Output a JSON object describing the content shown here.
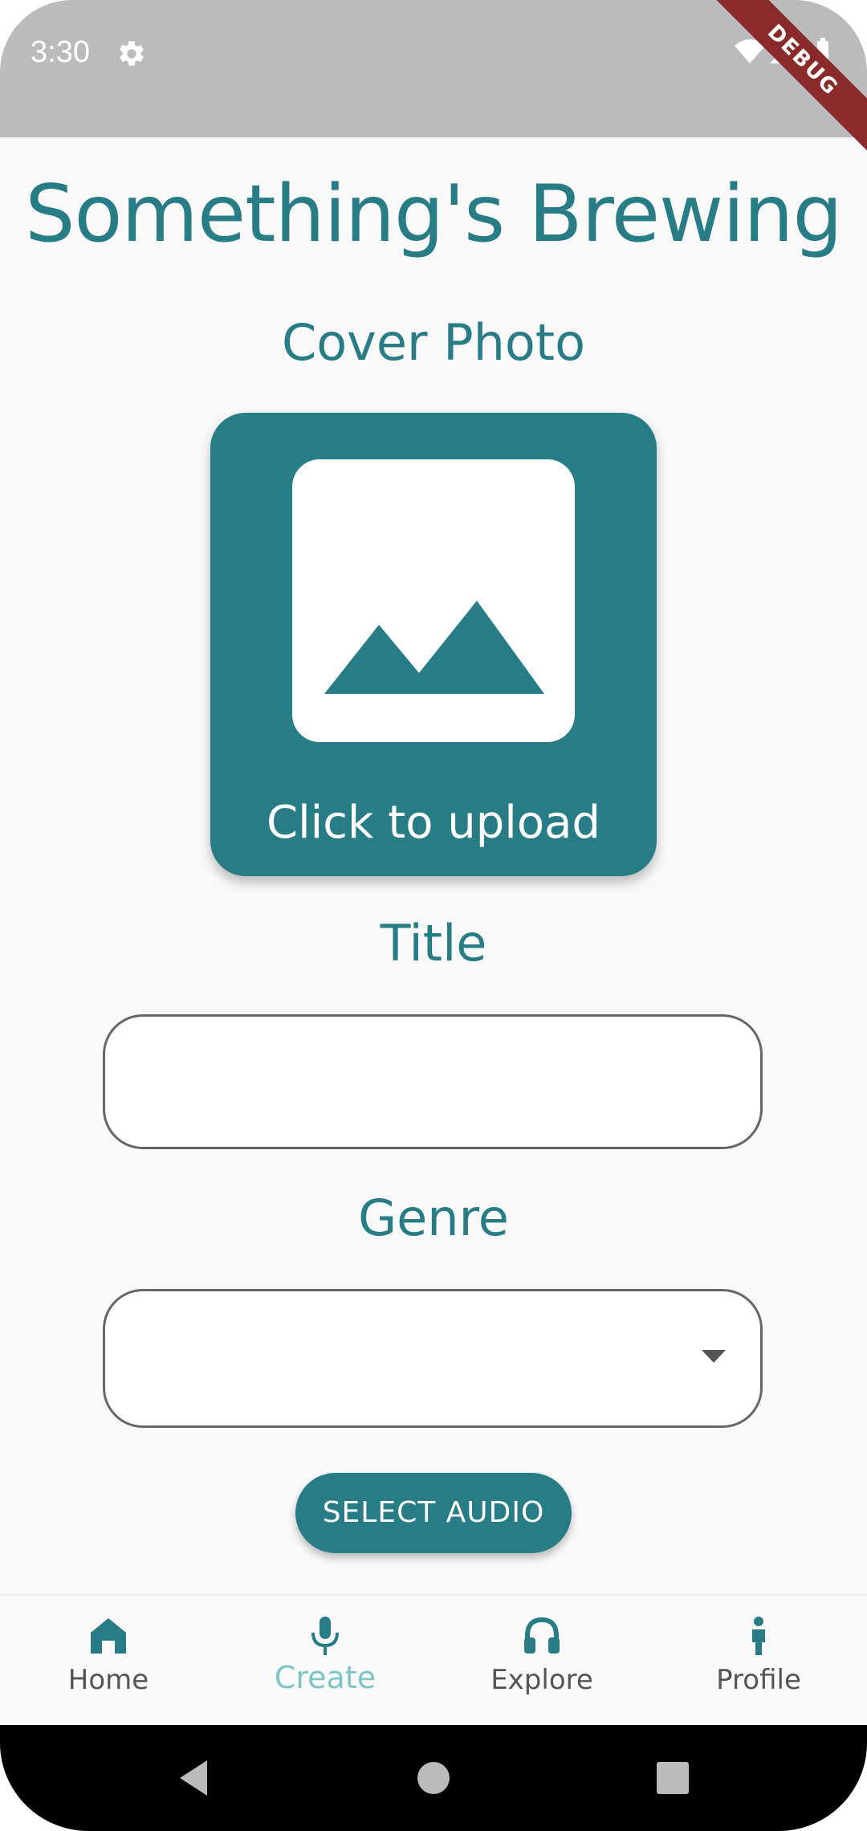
{
  "status_bar": {
    "time": "3:30",
    "settings_icon": "gear-icon",
    "wifi_icon": "wifi-icon",
    "signal_icon": "signal-icon",
    "battery_icon": "battery-icon",
    "debug_banner": "DEBUG"
  },
  "page": {
    "title": "Something's Brewing"
  },
  "cover_photo": {
    "label": "Cover Photo",
    "icon": "image-icon",
    "upload_text": "Click to upload"
  },
  "title_field": {
    "label": "Title",
    "value": ""
  },
  "genre_field": {
    "label": "Genre",
    "selected": "",
    "icon": "dropdown-arrow-icon"
  },
  "select_audio_button": {
    "label": "SELECT AUDIO"
  },
  "bottom_nav": {
    "items": [
      {
        "label": "Home",
        "icon": "home-icon",
        "active": false
      },
      {
        "label": "Create",
        "icon": "microphone-icon",
        "active": true
      },
      {
        "label": "Explore",
        "icon": "headphones-icon",
        "active": false
      },
      {
        "label": "Profile",
        "icon": "person-icon",
        "active": false
      }
    ]
  },
  "system_nav": {
    "back_icon": "back-triangle-icon",
    "home_icon": "home-circle-icon",
    "recents_icon": "recents-square-icon"
  },
  "colors": {
    "primary": "#287c85",
    "active_nav": "#7fc4c4",
    "status_bar": "#bbbbbb",
    "background": "#f9f9f9"
  }
}
